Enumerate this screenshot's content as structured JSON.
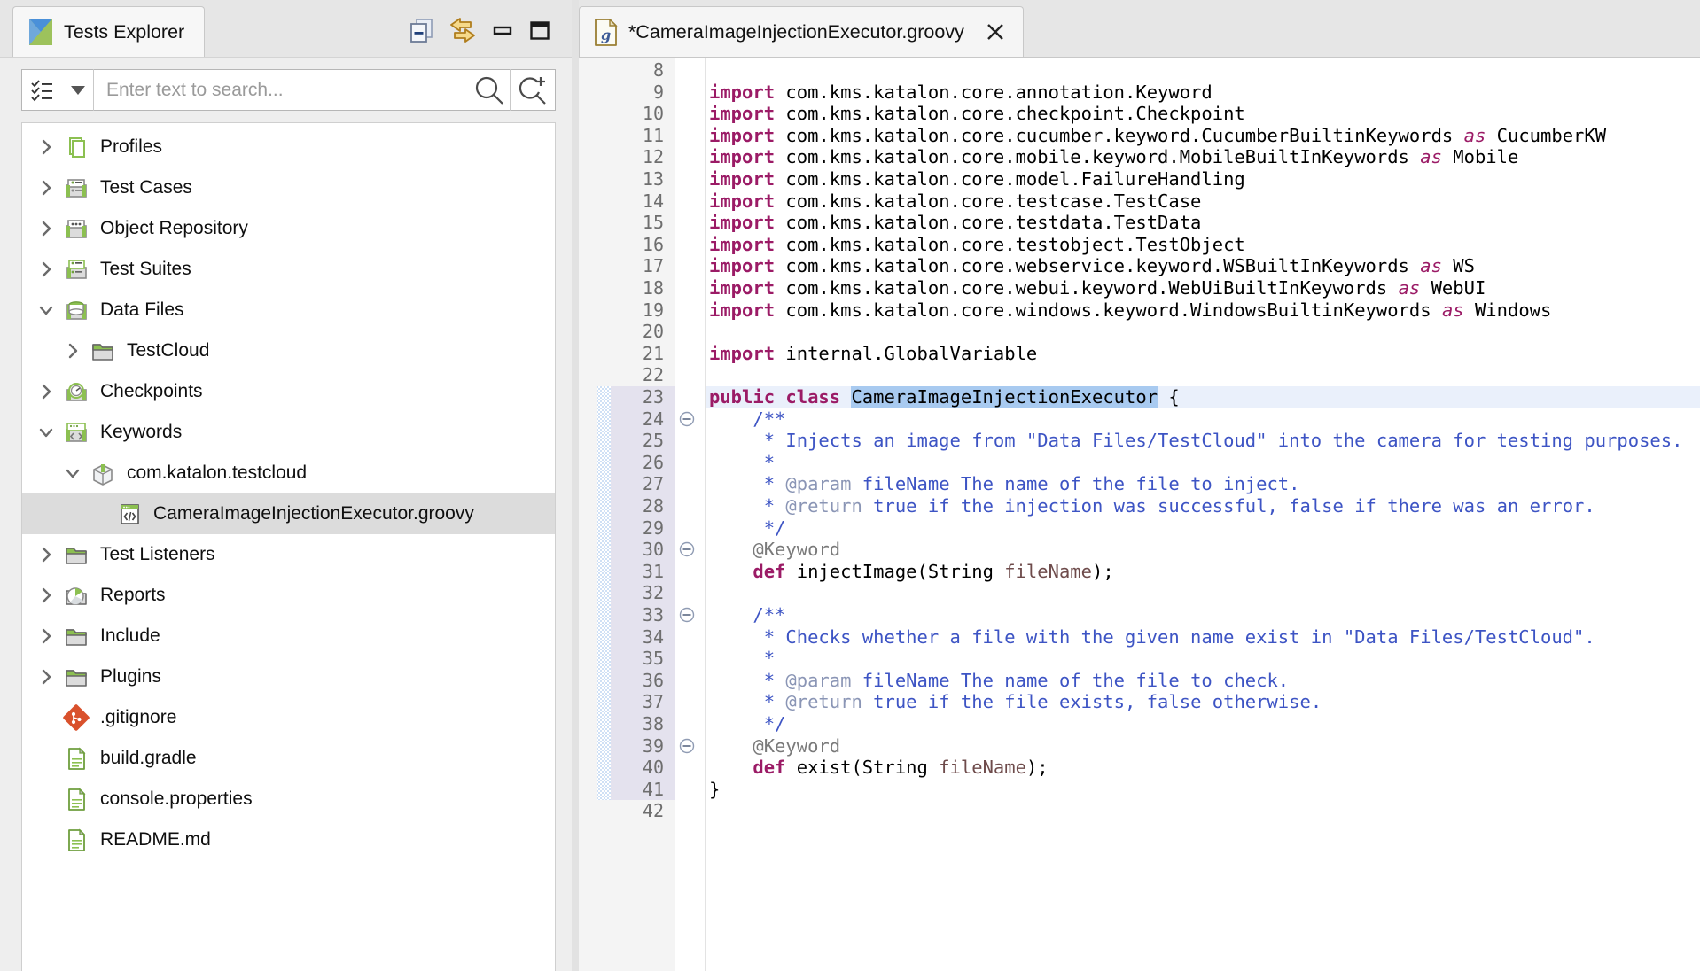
{
  "explorer": {
    "tab_title": "Tests Explorer",
    "tab_icon": "katalon-logo-icon",
    "toolbar": [
      {
        "name": "collapse-all-icon",
        "label": "Collapse All"
      },
      {
        "name": "link-with-editor-icon",
        "label": "Link with Editor"
      },
      {
        "name": "minimize-icon",
        "label": "Minimize"
      },
      {
        "name": "maximize-icon",
        "label": "Maximize"
      }
    ],
    "search": {
      "placeholder": "Enter text to search...",
      "value": "",
      "filter_icon": "checklist-icon",
      "dropdown_icon": "caret-down-icon",
      "search_icon": "search-icon",
      "new_search_icon": "search-plus-icon"
    },
    "tree": [
      {
        "label": "Profiles",
        "indent": 0,
        "twisty": "collapsed",
        "icon": "profiles-icon",
        "selected": false
      },
      {
        "label": "Test Cases",
        "indent": 0,
        "twisty": "collapsed",
        "icon": "testcase-icon",
        "selected": false
      },
      {
        "label": "Object Repository",
        "indent": 0,
        "twisty": "collapsed",
        "icon": "objectrepo-icon",
        "selected": false
      },
      {
        "label": "Test Suites",
        "indent": 0,
        "twisty": "collapsed",
        "icon": "testsuite-icon",
        "selected": false
      },
      {
        "label": "Data Files",
        "indent": 0,
        "twisty": "expanded",
        "icon": "datafiles-icon",
        "selected": false
      },
      {
        "label": "TestCloud",
        "indent": 1,
        "twisty": "collapsed",
        "icon": "folder-icon",
        "selected": false
      },
      {
        "label": "Checkpoints",
        "indent": 0,
        "twisty": "collapsed",
        "icon": "checkpoint-icon",
        "selected": false
      },
      {
        "label": "Keywords",
        "indent": 0,
        "twisty": "expanded",
        "icon": "keywords-icon",
        "selected": false
      },
      {
        "label": "com.katalon.testcloud",
        "indent": 1,
        "twisty": "expanded",
        "icon": "package-icon",
        "selected": false
      },
      {
        "label": "CameraImageInjectionExecutor.groovy",
        "indent": 2,
        "twisty": "none",
        "icon": "groovy-file-icon",
        "selected": true
      },
      {
        "label": "Test Listeners",
        "indent": 0,
        "twisty": "collapsed",
        "icon": "folder-icon",
        "selected": false
      },
      {
        "label": "Reports",
        "indent": 0,
        "twisty": "collapsed",
        "icon": "reports-icon",
        "selected": false
      },
      {
        "label": "Include",
        "indent": 0,
        "twisty": "collapsed",
        "icon": "folder-icon",
        "selected": false
      },
      {
        "label": "Plugins",
        "indent": 0,
        "twisty": "collapsed",
        "icon": "folder-icon",
        "selected": false
      },
      {
        "label": ".gitignore",
        "indent": 0,
        "twisty": "none",
        "icon": "git-icon",
        "selected": false
      },
      {
        "label": "build.gradle",
        "indent": 0,
        "twisty": "none",
        "icon": "file-icon",
        "selected": false
      },
      {
        "label": "console.properties",
        "indent": 0,
        "twisty": "none",
        "icon": "file-icon",
        "selected": false
      },
      {
        "label": "README.md",
        "indent": 0,
        "twisty": "none",
        "icon": "file-icon",
        "selected": false
      }
    ]
  },
  "editor": {
    "tab_title": "*CameraImageInjectionExecutor.groovy",
    "tab_icon": "groovy-file-icon",
    "close_icon": "close-icon",
    "dirty": true,
    "first_visible_line": 8,
    "cursor_line": 23,
    "selection_text": "CameraImageInjectionExecutor",
    "lines": [
      {
        "n": 8,
        "fold": false,
        "changed": false,
        "current": false,
        "tokens": []
      },
      {
        "n": 9,
        "fold": false,
        "changed": false,
        "current": false,
        "tokens": [
          {
            "t": "import",
            "c": "k"
          },
          {
            "t": " com.kms.katalon.core.annotation.Keyword",
            "c": ""
          }
        ]
      },
      {
        "n": 10,
        "fold": false,
        "changed": false,
        "current": false,
        "tokens": [
          {
            "t": "import",
            "c": "k"
          },
          {
            "t": " com.kms.katalon.core.checkpoint.Checkpoint",
            "c": ""
          }
        ]
      },
      {
        "n": 11,
        "fold": false,
        "changed": false,
        "current": false,
        "tokens": [
          {
            "t": "import",
            "c": "k"
          },
          {
            "t": " com.kms.katalon.core.cucumber.keyword.CucumberBuiltinKeywords ",
            "c": ""
          },
          {
            "t": "as",
            "c": "ki"
          },
          {
            "t": " CucumberKW",
            "c": ""
          }
        ]
      },
      {
        "n": 12,
        "fold": false,
        "changed": false,
        "current": false,
        "tokens": [
          {
            "t": "import",
            "c": "k"
          },
          {
            "t": " com.kms.katalon.core.mobile.keyword.MobileBuiltInKeywords ",
            "c": ""
          },
          {
            "t": "as",
            "c": "ki"
          },
          {
            "t": " Mobile",
            "c": ""
          }
        ]
      },
      {
        "n": 13,
        "fold": false,
        "changed": false,
        "current": false,
        "tokens": [
          {
            "t": "import",
            "c": "k"
          },
          {
            "t": " com.kms.katalon.core.model.FailureHandling",
            "c": ""
          }
        ]
      },
      {
        "n": 14,
        "fold": false,
        "changed": false,
        "current": false,
        "tokens": [
          {
            "t": "import",
            "c": "k"
          },
          {
            "t": " com.kms.katalon.core.testcase.TestCase",
            "c": ""
          }
        ]
      },
      {
        "n": 15,
        "fold": false,
        "changed": false,
        "current": false,
        "tokens": [
          {
            "t": "import",
            "c": "k"
          },
          {
            "t": " com.kms.katalon.core.testdata.TestData",
            "c": ""
          }
        ]
      },
      {
        "n": 16,
        "fold": false,
        "changed": false,
        "current": false,
        "tokens": [
          {
            "t": "import",
            "c": "k"
          },
          {
            "t": " com.kms.katalon.core.testobject.TestObject",
            "c": ""
          }
        ]
      },
      {
        "n": 17,
        "fold": false,
        "changed": false,
        "current": false,
        "tokens": [
          {
            "t": "import",
            "c": "k"
          },
          {
            "t": " com.kms.katalon.core.webservice.keyword.WSBuiltInKeywords ",
            "c": ""
          },
          {
            "t": "as",
            "c": "ki"
          },
          {
            "t": " WS",
            "c": ""
          }
        ]
      },
      {
        "n": 18,
        "fold": false,
        "changed": false,
        "current": false,
        "tokens": [
          {
            "t": "import",
            "c": "k"
          },
          {
            "t": " com.kms.katalon.core.webui.keyword.WebUiBuiltInKeywords ",
            "c": ""
          },
          {
            "t": "as",
            "c": "ki"
          },
          {
            "t": " WebUI",
            "c": ""
          }
        ]
      },
      {
        "n": 19,
        "fold": false,
        "changed": false,
        "current": false,
        "tokens": [
          {
            "t": "import",
            "c": "k"
          },
          {
            "t": " com.kms.katalon.core.windows.keyword.WindowsBuiltinKeywords ",
            "c": ""
          },
          {
            "t": "as",
            "c": "ki"
          },
          {
            "t": " Windows",
            "c": ""
          }
        ]
      },
      {
        "n": 20,
        "fold": false,
        "changed": false,
        "current": false,
        "tokens": []
      },
      {
        "n": 21,
        "fold": false,
        "changed": false,
        "current": false,
        "tokens": [
          {
            "t": "import",
            "c": "k"
          },
          {
            "t": " internal.GlobalVariable",
            "c": ""
          }
        ]
      },
      {
        "n": 22,
        "fold": false,
        "changed": false,
        "current": false,
        "tokens": []
      },
      {
        "n": 23,
        "fold": false,
        "changed": true,
        "current": true,
        "tokens": [
          {
            "t": "public class ",
            "c": "k"
          },
          {
            "t": "",
            "c": "caret"
          },
          {
            "t": "CameraImageInjectionExecutor",
            "c": "sel"
          },
          {
            "t": " {",
            "c": ""
          }
        ]
      },
      {
        "n": 24,
        "fold": true,
        "changed": true,
        "current": false,
        "tokens": [
          {
            "t": "    /**",
            "c": "cm"
          }
        ]
      },
      {
        "n": 25,
        "fold": false,
        "changed": true,
        "current": false,
        "tokens": [
          {
            "t": "     * Injects an image from \"Data Files/TestCloud\" into the camera for testing purposes.",
            "c": "cm"
          }
        ]
      },
      {
        "n": 26,
        "fold": false,
        "changed": true,
        "current": false,
        "tokens": [
          {
            "t": "     *",
            "c": "cm"
          }
        ]
      },
      {
        "n": 27,
        "fold": false,
        "changed": true,
        "current": false,
        "tokens": [
          {
            "t": "     * ",
            "c": "cm"
          },
          {
            "t": "@param",
            "c": "ct"
          },
          {
            "t": " fileName The name of the file to inject.",
            "c": "cm"
          }
        ]
      },
      {
        "n": 28,
        "fold": false,
        "changed": true,
        "current": false,
        "tokens": [
          {
            "t": "     * ",
            "c": "cm"
          },
          {
            "t": "@return",
            "c": "ct"
          },
          {
            "t": " true if the injection was successful, false if there was an error.",
            "c": "cm"
          }
        ]
      },
      {
        "n": 29,
        "fold": false,
        "changed": true,
        "current": false,
        "tokens": [
          {
            "t": "     */",
            "c": "cm"
          }
        ]
      },
      {
        "n": 30,
        "fold": true,
        "changed": true,
        "current": false,
        "tokens": [
          {
            "t": "    @Keyword",
            "c": "an"
          }
        ]
      },
      {
        "n": 31,
        "fold": false,
        "changed": true,
        "current": false,
        "tokens": [
          {
            "t": "    ",
            "c": ""
          },
          {
            "t": "def",
            "c": "k"
          },
          {
            "t": " injectImage(String ",
            "c": ""
          },
          {
            "t": "fileName",
            "c": "pm"
          },
          {
            "t": ");",
            "c": ""
          }
        ]
      },
      {
        "n": 32,
        "fold": false,
        "changed": true,
        "current": false,
        "tokens": []
      },
      {
        "n": 33,
        "fold": true,
        "changed": true,
        "current": false,
        "tokens": [
          {
            "t": "    /**",
            "c": "cm"
          }
        ]
      },
      {
        "n": 34,
        "fold": false,
        "changed": true,
        "current": false,
        "tokens": [
          {
            "t": "     * Checks whether a file with the given name exist in \"Data Files/TestCloud\".",
            "c": "cm"
          }
        ]
      },
      {
        "n": 35,
        "fold": false,
        "changed": true,
        "current": false,
        "tokens": [
          {
            "t": "     *",
            "c": "cm"
          }
        ]
      },
      {
        "n": 36,
        "fold": false,
        "changed": true,
        "current": false,
        "tokens": [
          {
            "t": "     * ",
            "c": "cm"
          },
          {
            "t": "@param",
            "c": "ct"
          },
          {
            "t": " fileName The name of the file to check.",
            "c": "cm"
          }
        ]
      },
      {
        "n": 37,
        "fold": false,
        "changed": true,
        "current": false,
        "tokens": [
          {
            "t": "     * ",
            "c": "cm"
          },
          {
            "t": "@return",
            "c": "ct"
          },
          {
            "t": " true if the file exists, false otherwise.",
            "c": "cm"
          }
        ]
      },
      {
        "n": 38,
        "fold": false,
        "changed": true,
        "current": false,
        "tokens": [
          {
            "t": "     */",
            "c": "cm"
          }
        ]
      },
      {
        "n": 39,
        "fold": true,
        "changed": true,
        "current": false,
        "tokens": [
          {
            "t": "    @Keyword",
            "c": "an"
          }
        ]
      },
      {
        "n": 40,
        "fold": false,
        "changed": true,
        "current": false,
        "tokens": [
          {
            "t": "    ",
            "c": ""
          },
          {
            "t": "def",
            "c": "k"
          },
          {
            "t": " exist(String ",
            "c": ""
          },
          {
            "t": "fileName",
            "c": "pm"
          },
          {
            "t": ");",
            "c": ""
          }
        ]
      },
      {
        "n": 41,
        "fold": false,
        "changed": true,
        "current": false,
        "tokens": [
          {
            "t": "}",
            "c": ""
          }
        ]
      },
      {
        "n": 42,
        "fold": false,
        "changed": false,
        "current": false,
        "tokens": []
      }
    ]
  },
  "colors": {
    "keyword": "#9b1b66",
    "comment": "#3d54c4",
    "javadoc_tag": "#8a95b5",
    "annotation": "#7a7a7a",
    "parameter": "#6e4b4b",
    "selection": "#a8caf0",
    "current_line": "#eaf0fb",
    "change_bar": "#cfe0f5",
    "tree_selection": "#dcdcdc",
    "katalon_green": "#8cc051",
    "katalon_blue": "#4a90d9"
  }
}
